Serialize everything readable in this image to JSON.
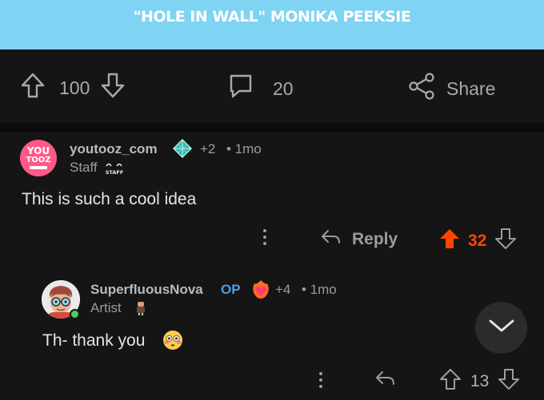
{
  "banner": {
    "title": "\"HOLE IN WALL\" MONIKA PEEKSIE"
  },
  "post_actions": {
    "score": "100",
    "comments": "20",
    "share_label": "Share"
  },
  "comments": [
    {
      "avatar_text_top": "YOU",
      "avatar_text_bottom": "TOOZ",
      "username": "youtooz_com",
      "award_icon": "diamond-award-icon",
      "award_count": "+2",
      "age": "• 1mo",
      "flair": "Staff",
      "flair_badge": "STAFF",
      "body": "This is such a cool idea",
      "reply_label": "Reply",
      "score": "32",
      "upvoted": true
    },
    {
      "username": "SuperfluousNova",
      "op_badge": "OP",
      "award_icon": "fire-heart-award-icon",
      "award_count": "+4",
      "age": "• 1mo",
      "flair": "Artist",
      "body": "Th- thank you",
      "emoji": "flushed-face-emoji",
      "score": "13",
      "online": true
    }
  ],
  "colors": {
    "banner": "#7fd3f3",
    "upvote_active": "#ff4500",
    "op": "#4a9ee6",
    "online": "#46d160"
  }
}
